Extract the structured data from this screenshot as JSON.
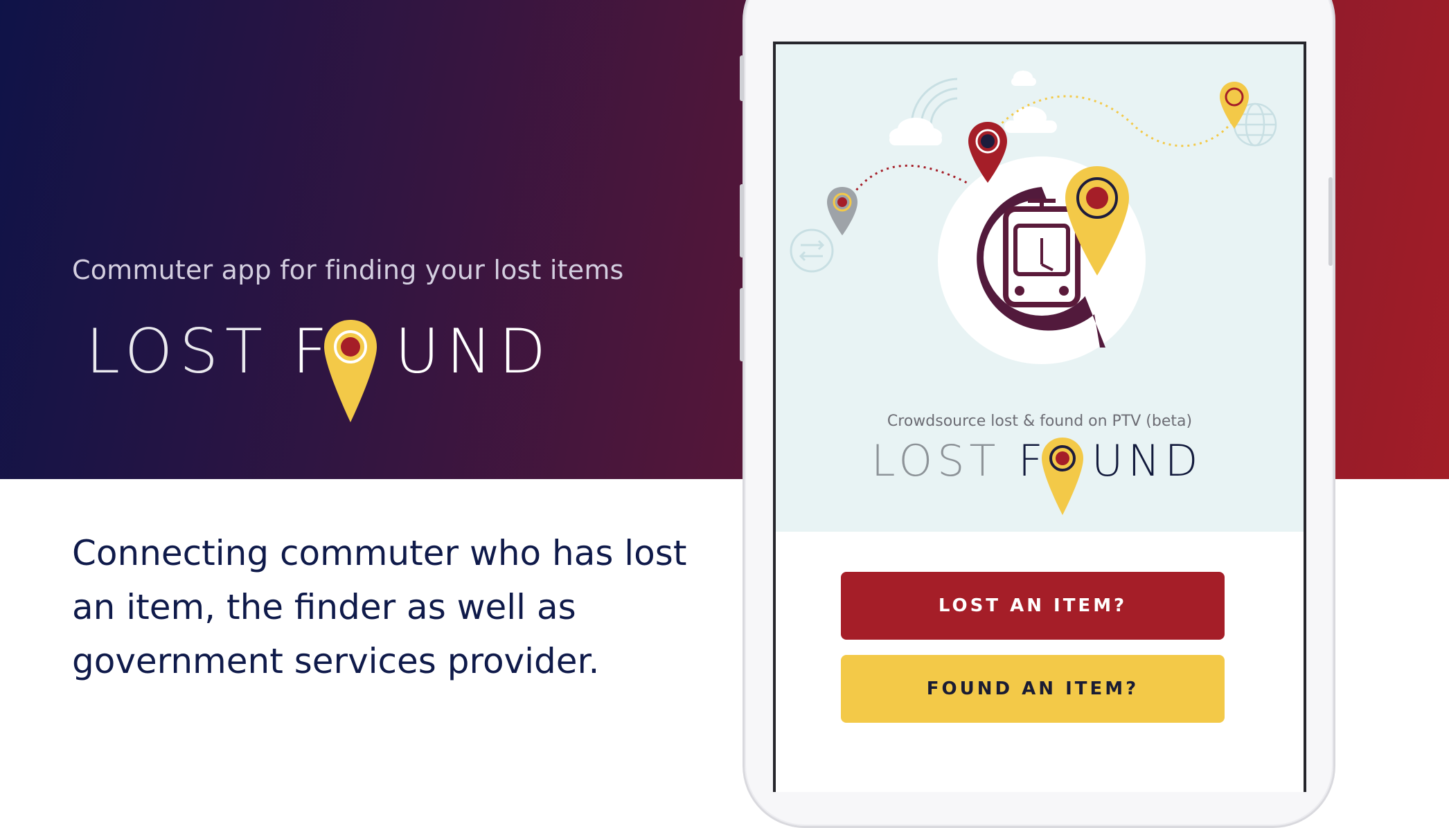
{
  "hero": {
    "tagline": "Commuter app for finding your lost items",
    "logo": {
      "word_lost": "LOST",
      "word_f": "F",
      "word_und": "UND"
    }
  },
  "description": "Connecting commuter who has lost an item, the finder as well as government services provider.",
  "phone_screen": {
    "subtitle": "Crowdsource lost & found on PTV (beta)",
    "logo": {
      "word_lost": "LOST",
      "word_f": "F",
      "word_und": "UND"
    },
    "buttons": {
      "lost_label": "LOST AN ITEM?",
      "found_label": "FOUND AN ITEM?"
    }
  },
  "colors": {
    "brand_red": "#a51e28",
    "brand_yellow": "#f3c948",
    "navy": "#0f1a4a",
    "screen_bg": "#e8f3f4"
  },
  "icons": [
    "map-pin-icon",
    "tram-icon",
    "cloud-icon",
    "globe-icon",
    "wifi-icon",
    "transfer-icon"
  ]
}
